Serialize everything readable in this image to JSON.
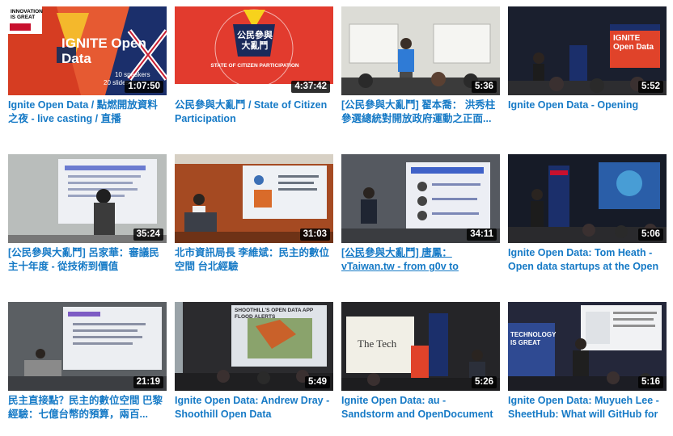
{
  "videos": [
    {
      "title": "Ignite Open Data / 點燃開放資料之夜 - live casting / 直播",
      "duration": "1:07:50",
      "thumb": {
        "bg": "#eaeaea",
        "accent": "#e2341d",
        "text": "IGNITE Open Data",
        "caption": "10 speakers",
        "caption2": "20 slides in",
        "badge": "INNOVATION IS GREAT"
      }
    },
    {
      "title": "公民參與大亂鬥 / State of Citizen Participation",
      "duration": "4:37:42",
      "thumb": {
        "bg": "#e03a2f",
        "accent": "#f7d21c",
        "text": "公民參與大亂鬥",
        "caption": "STATE OF CITIZEN PARTICIPATION"
      }
    },
    {
      "title": "[公民參與大亂鬥] 翟本喬： 洪秀柱參選總統對開放政府運動之正面...",
      "duration": "5:36",
      "thumb": {
        "bg": "#d9d9d3",
        "accent": "#2f7bd6"
      }
    },
    {
      "title": "Ignite Open Data - Opening",
      "duration": "5:52",
      "thumb": {
        "bg": "#1f2a4a",
        "accent": "#e2341d",
        "text": "IGNITE Open Data"
      }
    },
    {
      "title": "[公民參與大亂鬥] 呂家華：審議民主十年度 - 從技術到價值",
      "duration": "35:24",
      "thumb": {
        "bg": "#bfc3c0",
        "accent": "#6b7bd0"
      }
    },
    {
      "title": "北市資訊局長 李維斌：民主的數位空間 台北經驗",
      "duration": "31:03",
      "thumb": {
        "bg": "#a8441f",
        "accent": "#e8ecf2"
      }
    },
    {
      "title": "[公民參與大亂鬥] 唐鳳：vTaiwan.tw - from g0v to",
      "duration": "34:11",
      "thumb": {
        "bg": "#5b5f66",
        "accent": "#3f61c8"
      }
    },
    {
      "title": "Ignite Open Data: Tom Heath - Open data startups at the Open ...",
      "duration": "5:06",
      "thumb": {
        "bg": "#1c2230",
        "accent": "#3aa0e0"
      }
    },
    {
      "title": "民主直接點？民主的數位空間 巴黎經驗：七億台幣的預算，兩百...",
      "duration": "21:19",
      "thumb": {
        "bg": "#5e6266",
        "accent": "#7d5bc4"
      }
    },
    {
      "title": "Ignite Open Data: Andrew Dray - Shoothill Open Data",
      "duration": "5:49",
      "thumb": {
        "bg": "#2b2b2e",
        "accent": "#5f9ed6",
        "text": "SHOOTHILL'S OPEN DATA APP FLOOD ALERTS"
      }
    },
    {
      "title": "Ignite Open Data: au - Sandstorm and OpenDocument",
      "duration": "5:26",
      "thumb": {
        "bg": "#28282b",
        "accent": "#f1efe6",
        "text": "The Tech"
      }
    },
    {
      "title": "Ignite Open Data: Muyueh Lee - SheetHub: What will GitHub for ...",
      "duration": "5:16",
      "thumb": {
        "bg": "#26293a",
        "accent": "#2f4a92",
        "text": "TECHNOLOGY IS GREAT"
      }
    }
  ]
}
